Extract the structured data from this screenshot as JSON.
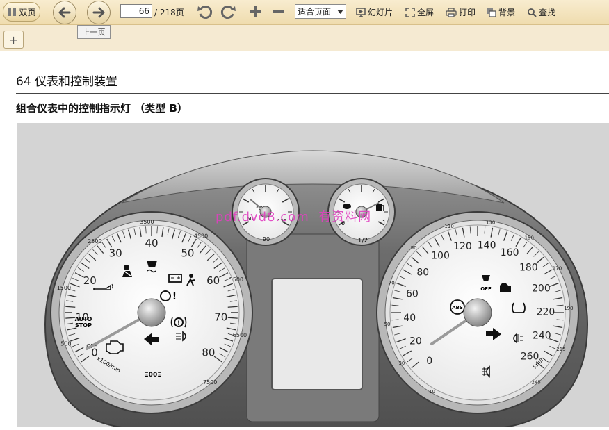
{
  "toolbar": {
    "dual_page_label": "双页",
    "current_page": "66",
    "page_total": "/ 218页",
    "zoom_mode": "适合页面",
    "slideshow_label": "幻灯片",
    "fullscreen_label": "全屏",
    "print_label": "打印",
    "background_label": "背景",
    "search_label": "查找",
    "prev_tooltip": "上一页"
  },
  "tabs": {
    "add_label": "+"
  },
  "document": {
    "header": "64 仪表和控制装置",
    "section_title": "组合仪表中的控制指示灯 （类型 B）",
    "watermark": "pdf.dvd8.com  有资料网"
  },
  "cluster": {
    "tach_numbers": [
      "0",
      "10",
      "20",
      "30",
      "40",
      "50",
      "60",
      "70",
      "80"
    ],
    "tach_rpm": [
      "500",
      "1500",
      "2500",
      "3500",
      "4500",
      "5500",
      "6500",
      "7500"
    ],
    "tach_unit": "x100/min",
    "tach_off_label": "OFF",
    "autostop": "AUTO",
    "autostop2": "STOP",
    "temp_unit": "°C",
    "temp_low": "50",
    "temp_mid": "90",
    "temp_high": "130",
    "fuel_empty": "0",
    "fuel_half": "1/2",
    "fuel_full": "1",
    "speed_numbers": [
      "0",
      "20",
      "40",
      "60",
      "80",
      "100",
      "120",
      "140",
      "160",
      "180",
      "200",
      "220",
      "240",
      "260"
    ],
    "speed_outer": [
      "10",
      "30",
      "50",
      "70",
      "90",
      "110",
      "130",
      "150",
      "170",
      "190",
      "215",
      "245"
    ],
    "speed_unit": "km/h",
    "esp_off": "OFF",
    "abs": "ABS"
  }
}
